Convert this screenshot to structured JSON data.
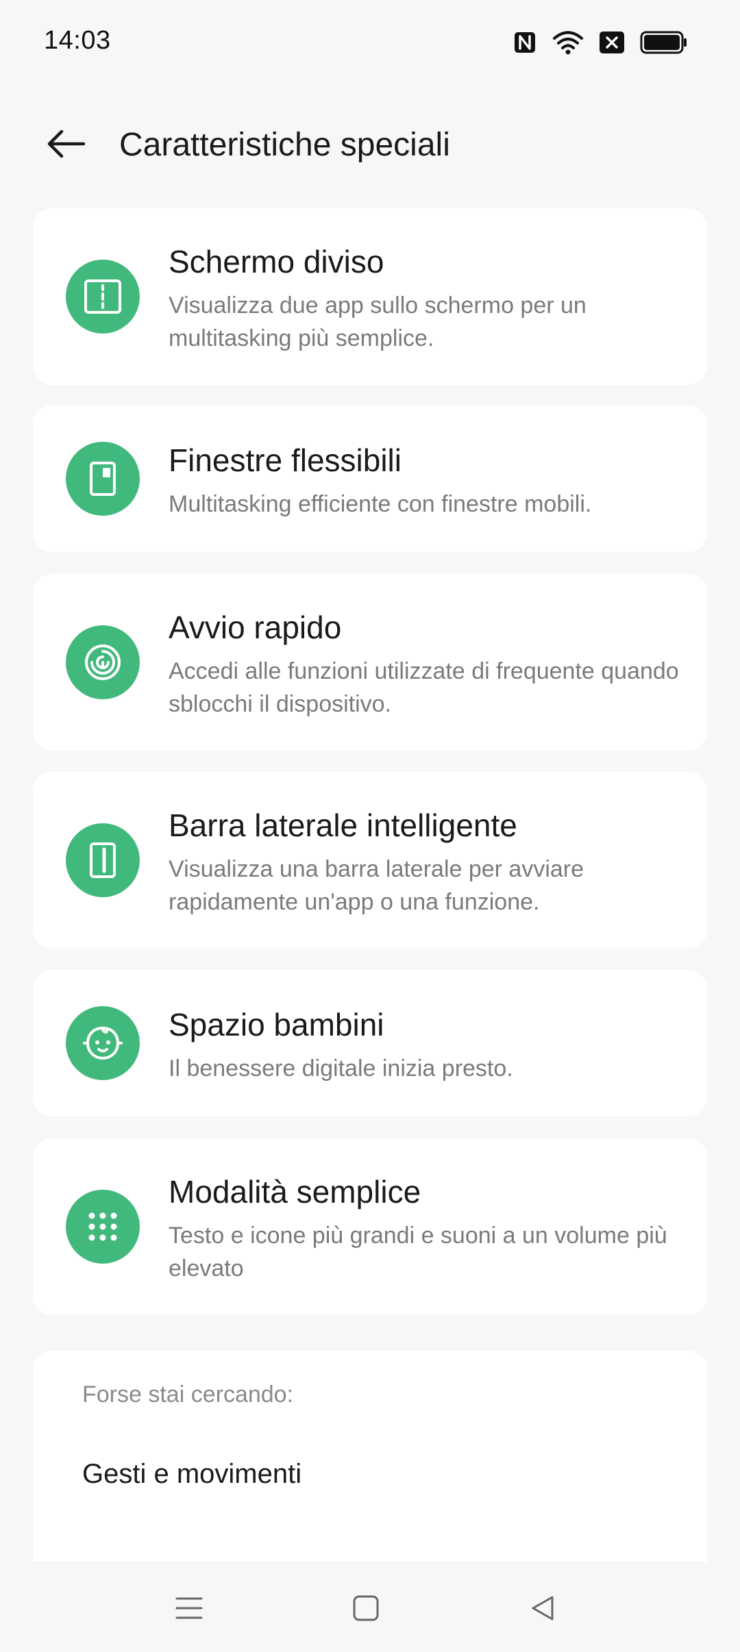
{
  "status_bar": {
    "time": "14:03",
    "icons": [
      "nfc-icon",
      "wifi-icon",
      "no-sim-icon",
      "battery-icon"
    ]
  },
  "header": {
    "title": "Caratteristiche speciali",
    "back_icon": "arrow-left-icon"
  },
  "accent_color": "#42b97c",
  "features": [
    {
      "title": "Schermo diviso",
      "subtitle": "Visualizza due app sullo schermo per un multitasking più semplice.",
      "icon": "split-screen-icon"
    },
    {
      "title": "Finestre flessibili",
      "subtitle": "Multitasking efficiente con finestre mobili.",
      "icon": "flexible-window-icon"
    },
    {
      "title": "Avvio rapido",
      "subtitle": "Accedi alle funzioni utilizzate di frequente quando sblocchi il dispositivo.",
      "icon": "fingerprint-icon"
    },
    {
      "title": "Barra laterale intelligente",
      "subtitle": "Visualizza una barra laterale per avviare rapidamente un'app o una funzione.",
      "icon": "sidebar-icon"
    },
    {
      "title": "Spazio bambini",
      "subtitle": "Il benessere digitale inizia presto.",
      "icon": "baby-face-icon"
    },
    {
      "title": "Modalità semplice",
      "subtitle": "Testo e icone più grandi e suoni a un volume più elevato",
      "icon": "dots-grid-icon"
    }
  ],
  "suggestions": {
    "heading": "Forse stai cercando:",
    "items": [
      "Gesti e movimenti"
    ]
  },
  "nav_bar": {
    "icons": [
      "menu-icon",
      "home-icon",
      "back-triangle-icon"
    ]
  }
}
